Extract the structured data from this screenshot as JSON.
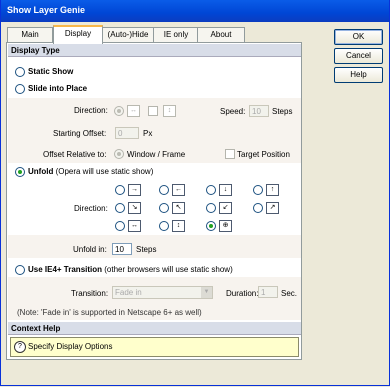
{
  "window": {
    "title": "Show Layer Genie"
  },
  "tabs": [
    "Main",
    "Display",
    "(Auto-)Hide",
    "IE only",
    "About"
  ],
  "active_tab": "Display",
  "buttons": {
    "ok": "OK",
    "cancel": "Cancel",
    "help": "Help"
  },
  "display_type": {
    "heading": "Display Type",
    "static_show": "Static Show",
    "slide_into_place": "Slide into Place",
    "direction_label": "Direction:",
    "speed_label": "Speed:",
    "speed_value": "10",
    "speed_unit": "Steps",
    "starting_offset_label": "Starting Offset:",
    "starting_offset_value": "0",
    "starting_offset_unit": "Px",
    "offset_relative_label": "Offset Relative to:",
    "window_frame": "Window / Frame",
    "target_position": "Target Position",
    "unfold_label": "Unfold",
    "unfold_note": "(Opera will use static show)",
    "unfold_direction_label": "Direction:",
    "unfold_in_label": "Unfold in:",
    "unfold_in_value": "10",
    "unfold_in_unit": "Steps",
    "ie_transition_label": "Use IE4+ Transition",
    "ie_transition_note": "(other browsers will use static show)",
    "transition_label": "Transition:",
    "transition_value": "Fade in",
    "duration_label": "Duration:",
    "duration_value": "1",
    "duration_unit": "Sec.",
    "note": "(Note: 'Fade in' is supported in Netscape 6+ as well)",
    "selected_mode": "Unfold"
  },
  "context_help": {
    "heading": "Context Help",
    "text": "Specify Display Options"
  },
  "icons": {
    "slide_dir": [
      "↔",
      "↕"
    ],
    "unfold_dirs": [
      "→",
      "←",
      "↓",
      "↑",
      "↘",
      "↖",
      "↙",
      "↗",
      "↔",
      "↕",
      "⊕"
    ]
  }
}
